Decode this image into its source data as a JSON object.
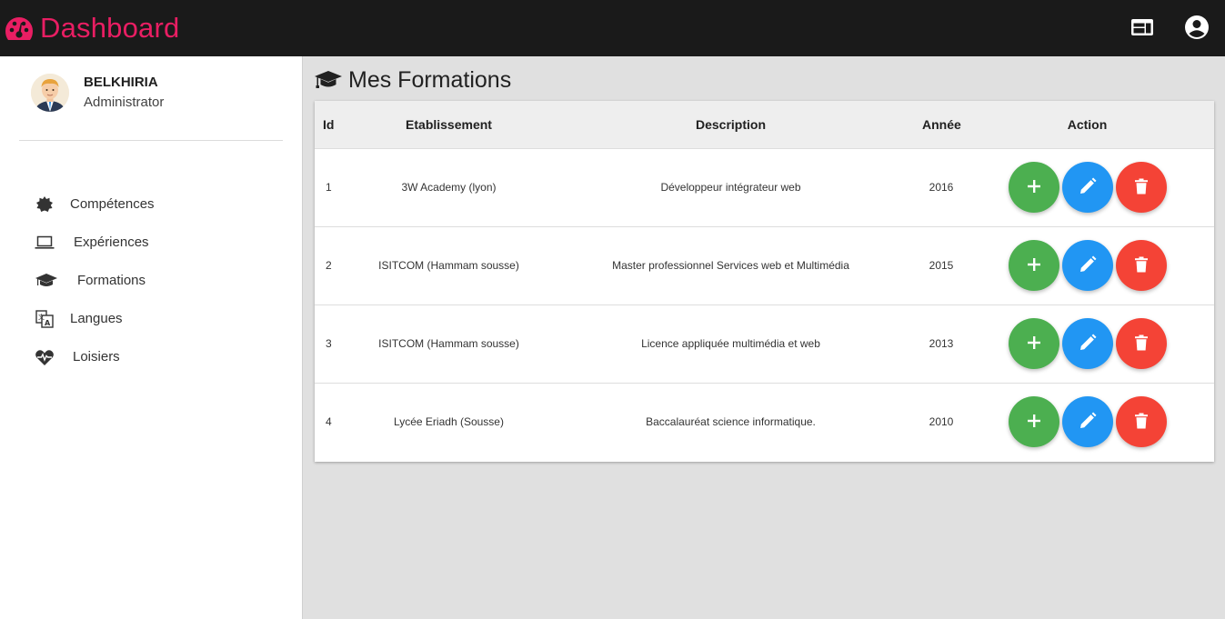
{
  "header": {
    "title": "Dashboard",
    "brand_color": "#e91e63",
    "icons": [
      "dashboard-gauge-icon",
      "web-layout-icon",
      "account-circle-icon"
    ]
  },
  "sidebar": {
    "user": {
      "name": "BELKHIRIA",
      "role": "Administrator"
    },
    "items": [
      {
        "label": "Compétences",
        "icon": "badge-star-icon"
      },
      {
        "label": "Expériences",
        "icon": "laptop-icon"
      },
      {
        "label": "Formations",
        "icon": "graduation-cap-icon"
      },
      {
        "label": "Langues",
        "icon": "translate-icon"
      },
      {
        "label": "Loisiers",
        "icon": "heartbeat-icon"
      }
    ]
  },
  "main": {
    "title": "Mes Formations",
    "title_icon": "graduation-cap-icon",
    "table": {
      "columns": [
        "Id",
        "Etablissement",
        "Description",
        "Année",
        "Action"
      ],
      "rows": [
        {
          "id": "1",
          "etablissement": "3W Academy (lyon)",
          "description": "Développeur intégrateur web",
          "annee": "2016"
        },
        {
          "id": "2",
          "etablissement": "ISITCOM (Hammam sousse)",
          "description": "Master professionnel Services web et Multimédia",
          "annee": "2015"
        },
        {
          "id": "3",
          "etablissement": "ISITCOM (Hammam sousse)",
          "description": "Licence appliquée multimédia et web",
          "annee": "2013"
        },
        {
          "id": "4",
          "etablissement": "Lycée Eriadh (Sousse)",
          "description": "Baccalauréat science informatique.",
          "annee": "2010"
        }
      ],
      "action_icons": [
        "plus-icon",
        "pencil-icon",
        "trash-icon"
      ],
      "action_colors": {
        "add": "#4caf50",
        "edit": "#2196f3",
        "delete": "#f44336"
      }
    }
  }
}
